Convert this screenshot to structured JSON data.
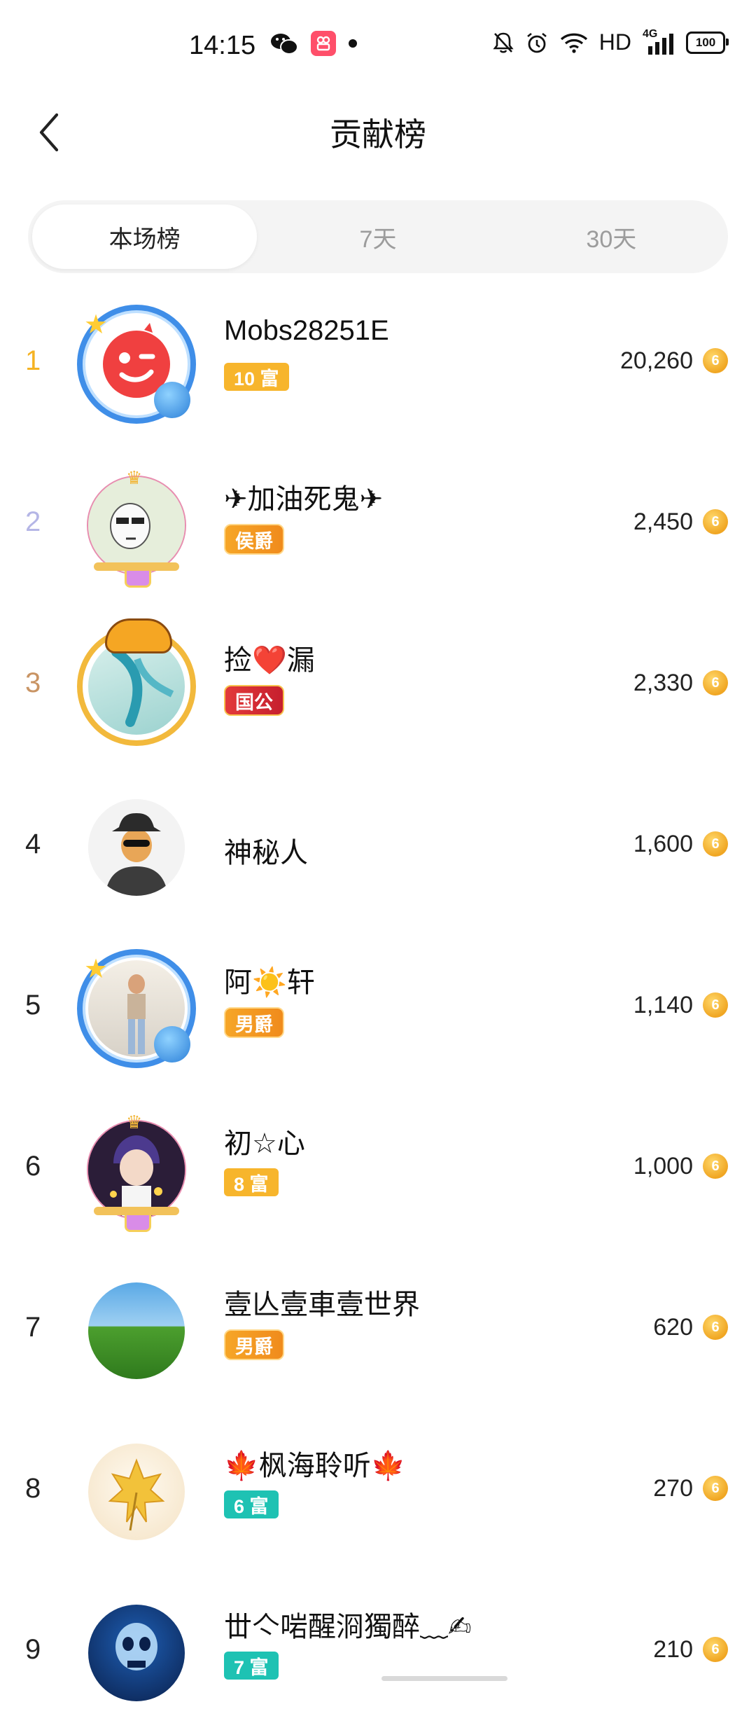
{
  "status_bar": {
    "time": "14:15",
    "network": "HD",
    "signal_label": "4G",
    "battery": "100",
    "icons": [
      "wechat-icon",
      "app-icon",
      "dot-icon",
      "mute-bell-icon",
      "alarm-icon",
      "wifi-icon",
      "signal-icon",
      "battery-icon"
    ]
  },
  "header": {
    "title": "贡献榜",
    "back_icon": "chevron-left-icon"
  },
  "tabs": [
    {
      "label": "本场榜",
      "active": true
    },
    {
      "label": "7天",
      "active": false
    },
    {
      "label": "30天",
      "active": false
    }
  ],
  "ranking": [
    {
      "rank": "1",
      "name": "Mobs28251E",
      "badge": "10 富",
      "badge_type": "rich",
      "score": "20,260",
      "avatar": "red-smile-face",
      "frame": "blue-planet"
    },
    {
      "rank": "2",
      "name": "✈加油死鬼✈",
      "badge": "侯爵",
      "badge_type": "noble",
      "score": "2,450",
      "avatar": "cartoon-sunglasses",
      "frame": "pink-crown"
    },
    {
      "rank": "3",
      "name": "捡❤️漏",
      "badge": "国公",
      "badge_type": "noble-red",
      "score": "2,330",
      "avatar": "horse-painting",
      "frame": "tiger"
    },
    {
      "rank": "4",
      "name": "神秘人",
      "badge": "",
      "badge_type": "none",
      "score": "1,600",
      "avatar": "mystery-man",
      "frame": "none"
    },
    {
      "rank": "5",
      "name": "阿☀️轩",
      "badge": "男爵",
      "badge_type": "noble",
      "score": "1,140",
      "avatar": "girl-photo",
      "frame": "blue-planet"
    },
    {
      "rank": "6",
      "name": "初☆心",
      "badge": "8 富",
      "badge_type": "rich",
      "score": "1,000",
      "avatar": "anime-boy",
      "frame": "pink-crown"
    },
    {
      "rank": "7",
      "name": "壹亾壹車壹世界",
      "badge": "男爵",
      "badge_type": "noble",
      "score": "620",
      "avatar": "green-hill",
      "frame": "none"
    },
    {
      "rank": "8",
      "name": "🍁枫海聆听🍁",
      "badge": "6 富",
      "badge_type": "rich-teal",
      "score": "270",
      "avatar": "autumn-leaf",
      "frame": "none"
    },
    {
      "rank": "9",
      "name": "丗亽啱醒浻獨醉﹏✍",
      "badge": "7 富",
      "badge_type": "rich-teal",
      "score": "210",
      "avatar": "skull",
      "frame": "none"
    }
  ],
  "coin_symbol": "6",
  "colors": {
    "gold": "#f5b323",
    "silver": "#b5b6e6",
    "bronze": "#c99464",
    "rich_badge": "#f7b52c",
    "teal_badge": "#1ec2b3"
  }
}
